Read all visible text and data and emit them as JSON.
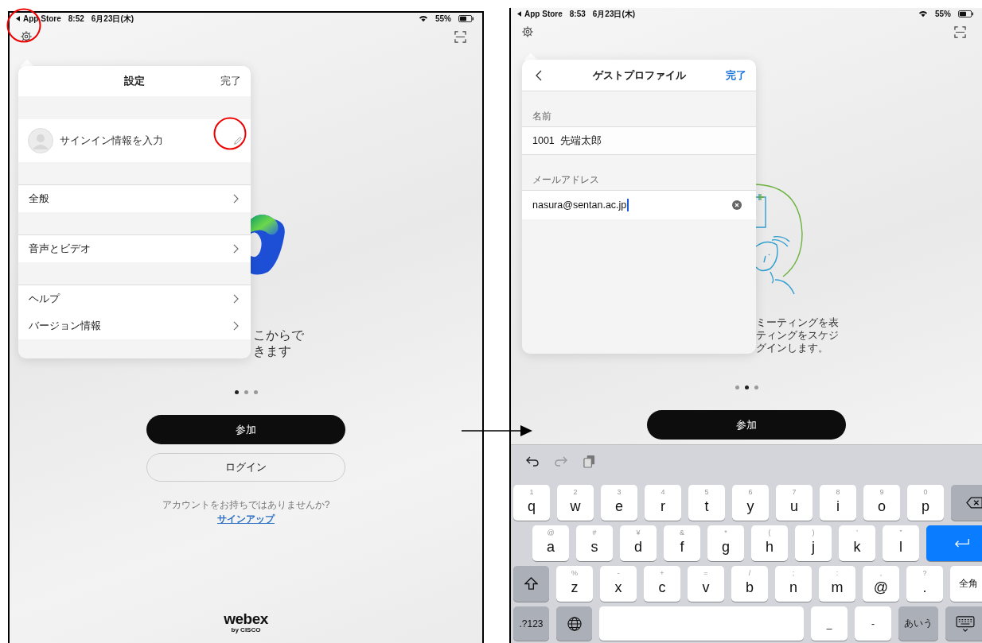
{
  "left_screen": {
    "status_bar": {
      "app": "App Store",
      "time": "8:52",
      "date": "6月23日(木)",
      "battery": "55%"
    },
    "settings_popover": {
      "title": "設定",
      "done": "完了",
      "profile_row": {
        "label": "サインイン情報を入力"
      },
      "groups": [
        {
          "items": [
            {
              "label": "全般"
            }
          ]
        },
        {
          "items": [
            {
              "label": "音声とビデオ"
            }
          ]
        },
        {
          "items": [
            {
              "label": "ヘルプ"
            },
            {
              "label": "バージョン情報"
            }
          ]
        }
      ]
    },
    "background_text": [
      "こからで",
      "きます"
    ],
    "page_dots": [
      {
        "selected": true
      },
      {
        "selected": false
      },
      {
        "selected": false
      }
    ],
    "join_button": "参加",
    "login_button": "ログイン",
    "signup_prompt": "アカウントをお持ちではありませんか?",
    "signup_link": "サインアップ",
    "brand": "webex",
    "brand_sub": "by CISCO"
  },
  "right_screen": {
    "status_bar": {
      "app": "App Store",
      "time": "8:53",
      "date": "6月23日(木)",
      "battery": "55%"
    },
    "profile_popover": {
      "title": "ゲストプロファイル",
      "done": "完了",
      "fields": [
        {
          "label": "名前",
          "value": "1001  先端太郎",
          "focused": false
        },
        {
          "label": "メールアドレス",
          "value": "nasura@sentan.ac.jp",
          "focused": true
        }
      ]
    },
    "background_text": [
      "ミーティングを表",
      "ティングをスケジ",
      "グインします。"
    ],
    "page_dots": [
      {
        "selected": false
      },
      {
        "selected": true
      },
      {
        "selected": false
      }
    ],
    "join_button": "参加",
    "keyboard": {
      "rows": [
        {
          "keys": [
            {
              "kind": "letter",
              "label": "q",
              "hint": "1"
            },
            {
              "kind": "letter",
              "label": "w",
              "hint": "2"
            },
            {
              "kind": "letter",
              "label": "e",
              "hint": "3"
            },
            {
              "kind": "letter",
              "label": "r",
              "hint": "4"
            },
            {
              "kind": "letter",
              "label": "t",
              "hint": "5"
            },
            {
              "kind": "letter",
              "label": "y",
              "hint": "6"
            },
            {
              "kind": "letter",
              "label": "u",
              "hint": "7"
            },
            {
              "kind": "letter",
              "label": "i",
              "hint": "8"
            },
            {
              "kind": "letter",
              "label": "o",
              "hint": "9"
            },
            {
              "kind": "letter",
              "label": "p",
              "hint": "0"
            },
            {
              "kind": "backspace"
            }
          ]
        },
        {
          "keys": [
            {
              "kind": "letter",
              "label": "a",
              "hint": "@"
            },
            {
              "kind": "letter",
              "label": "s",
              "hint": "#"
            },
            {
              "kind": "letter",
              "label": "d",
              "hint": "¥"
            },
            {
              "kind": "letter",
              "label": "f",
              "hint": "&"
            },
            {
              "kind": "letter",
              "label": "g",
              "hint": "*"
            },
            {
              "kind": "letter",
              "label": "h",
              "hint": "("
            },
            {
              "kind": "letter",
              "label": "j",
              "hint": ")"
            },
            {
              "kind": "letter",
              "label": "k",
              "hint": "’"
            },
            {
              "kind": "letter",
              "label": "l",
              "hint": "”"
            },
            {
              "kind": "return"
            }
          ]
        },
        {
          "keys": [
            {
              "kind": "shift"
            },
            {
              "kind": "letter",
              "label": "z",
              "hint": "%"
            },
            {
              "kind": "letter",
              "label": "x",
              "hint": "-"
            },
            {
              "kind": "letter",
              "label": "c",
              "hint": "+"
            },
            {
              "kind": "letter",
              "label": "v",
              "hint": "="
            },
            {
              "kind": "letter",
              "label": "b",
              "hint": "/"
            },
            {
              "kind": "letter",
              "label": "n",
              "hint": ";"
            },
            {
              "kind": "letter",
              "label": "m",
              "hint": ":"
            },
            {
              "kind": "letter",
              "label": "@",
              "hint": ","
            },
            {
              "kind": "letter",
              "label": ".",
              "hint": "?"
            },
            {
              "kind": "text",
              "label": "全角"
            }
          ]
        },
        {
          "keys": [
            {
              "kind": "mode",
              "label": ".?123"
            },
            {
              "kind": "globe"
            },
            {
              "kind": "space"
            },
            {
              "kind": "text",
              "label": "_"
            },
            {
              "kind": "text",
              "label": "-"
            },
            {
              "kind": "mode",
              "label": "あいう"
            },
            {
              "kind": "dismiss"
            }
          ]
        }
      ]
    }
  }
}
